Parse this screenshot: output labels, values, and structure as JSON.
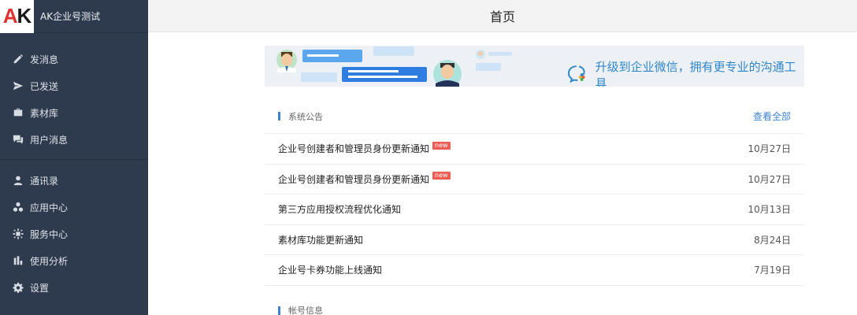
{
  "app": {
    "logo_a": "A",
    "logo_k": "K",
    "name": "AK企业号测试"
  },
  "header": {
    "title": "首页"
  },
  "sidebar": {
    "groups": [
      [
        {
          "label": "发消息",
          "icon": "pencil-icon"
        },
        {
          "label": "已发送",
          "icon": "send-icon"
        },
        {
          "label": "素材库",
          "icon": "briefcase-icon"
        },
        {
          "label": "用户消息",
          "icon": "chat-icon"
        }
      ],
      [
        {
          "label": "通讯录",
          "icon": "user-icon"
        },
        {
          "label": "应用中心",
          "icon": "apps-icon"
        },
        {
          "label": "服务中心",
          "icon": "service-icon"
        },
        {
          "label": "使用分析",
          "icon": "bar-chart-icon"
        },
        {
          "label": "设置",
          "icon": "gear-icon"
        }
      ]
    ]
  },
  "banner": {
    "text": "升级到企业微信，拥有更专业的沟通工具"
  },
  "announcements": {
    "title": "系统公告",
    "view_all": "查看全部",
    "items": [
      {
        "title": "企业号创建者和管理员身份更新通知",
        "badge": "new",
        "date": "10月27日"
      },
      {
        "title": "企业号创建者和管理员身份更新通知",
        "badge": "new",
        "date": "10月27日"
      },
      {
        "title": "第三方应用授权流程优化通知",
        "badge": "",
        "date": "10月13日"
      },
      {
        "title": "素材库功能更新通知",
        "badge": "",
        "date": "8月24日"
      },
      {
        "title": "企业号卡券功能上线通知",
        "badge": "",
        "date": "7月19日"
      }
    ]
  },
  "account": {
    "title": "帐号信息"
  },
  "colors": {
    "sidebar": "#2e3a4d",
    "accent": "#3d82d0",
    "badge": "#ef5c54"
  }
}
